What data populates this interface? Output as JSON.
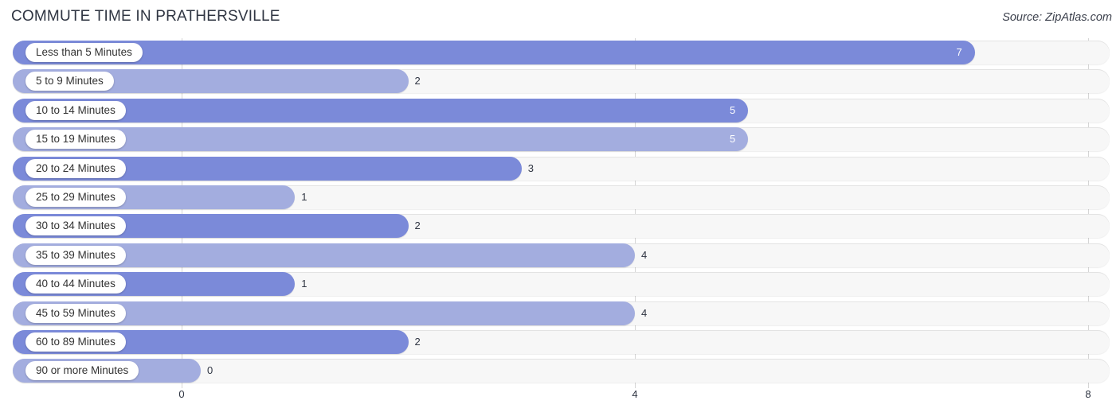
{
  "header": {
    "title": "COMMUTE TIME IN PRATHERSVILLE",
    "source": "Source: ZipAtlas.com"
  },
  "colors": {
    "bar_dark": "#7b8ad9",
    "bar_light": "#a3addf",
    "track": "#f7f7f7",
    "gridline": "#d6d6d6",
    "title": "#2f3542",
    "value_inside": "#ffffff",
    "value_outside": "#2f3542"
  },
  "chart_data": {
    "type": "bar",
    "orientation": "horizontal",
    "title": "COMMUTE TIME IN PRATHERSVILLE",
    "xlabel": "",
    "ylabel": "",
    "xlim": [
      0,
      8
    ],
    "xticks": [
      0,
      4,
      8
    ],
    "xtick_labels": [
      "0",
      "4",
      "8"
    ],
    "grid": true,
    "legend": false,
    "categories": [
      "Less than 5 Minutes",
      "5 to 9 Minutes",
      "10 to 14 Minutes",
      "15 to 19 Minutes",
      "20 to 24 Minutes",
      "25 to 29 Minutes",
      "30 to 34 Minutes",
      "35 to 39 Minutes",
      "40 to 44 Minutes",
      "45 to 59 Minutes",
      "60 to 89 Minutes",
      "90 or more Minutes"
    ],
    "values": [
      7,
      2,
      5,
      5,
      3,
      1,
      2,
      4,
      1,
      4,
      2,
      0
    ],
    "value_labels": [
      "7",
      "2",
      "5",
      "5",
      "3",
      "1",
      "2",
      "4",
      "1",
      "4",
      "2",
      "0"
    ]
  }
}
